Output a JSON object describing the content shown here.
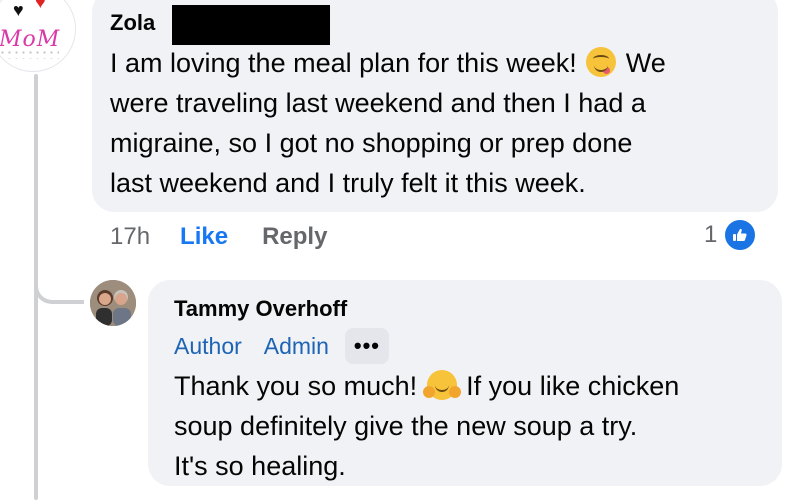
{
  "comment": {
    "author": "Zola",
    "avatar_text": "MoM",
    "lines": [
      "I am loving the meal plan for this week!",
      "We",
      "were traveling last weekend and then I had a",
      "migraine, so I got no shopping or prep done",
      "last weekend and I truly felt it this week."
    ],
    "emoji": "face-savoring-food-icon",
    "time": "17h",
    "like_label": "Like",
    "reply_label": "Reply",
    "reaction_count": "1"
  },
  "reply": {
    "author": "Tammy Overhoff",
    "badges": [
      "Author",
      "Admin"
    ],
    "more_label": "•••",
    "lines": [
      "Thank you so much!",
      "If you like chicken",
      "soup definitely give the new soup a try.",
      "It's so healing."
    ],
    "emoji": "hugging-face-icon"
  },
  "colors": {
    "bubble_bg": "#f0f2f5",
    "link_blue": "#1877f2",
    "badge_blue": "#1d64b4",
    "muted_gray": "#65676b",
    "like_badge": "#1b74e4"
  }
}
